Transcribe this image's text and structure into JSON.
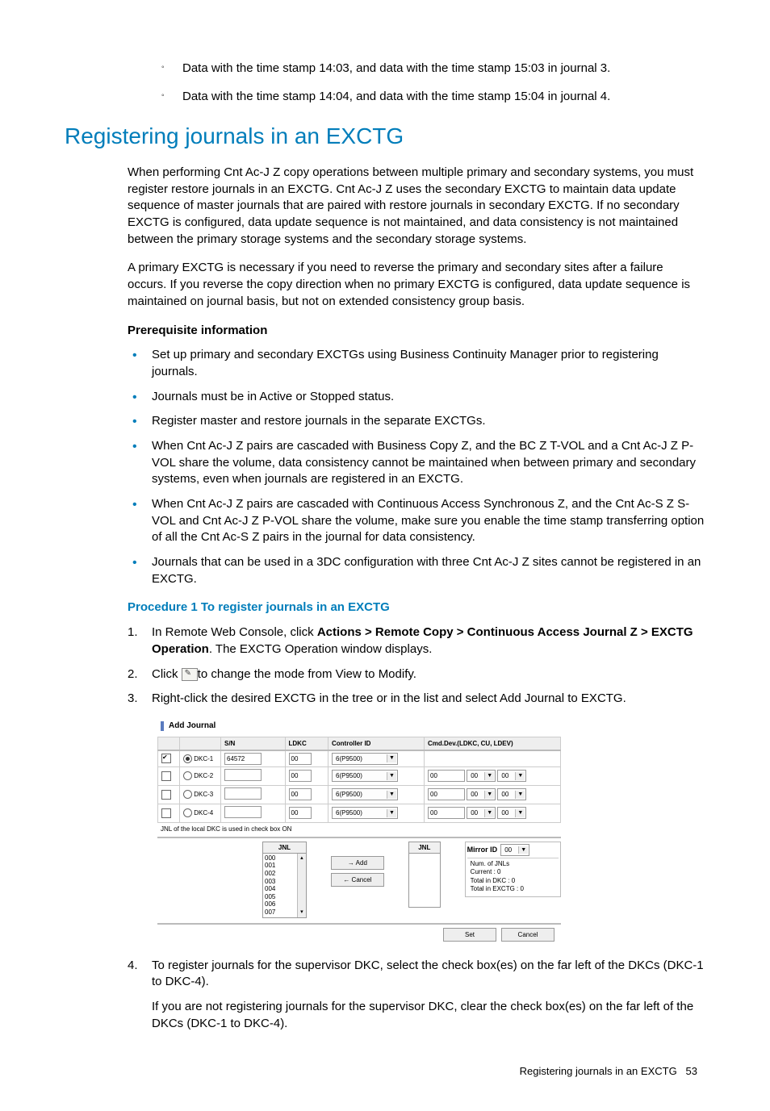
{
  "top_bullets": [
    "Data with the time stamp 14:03, and data with the time stamp 15:03 in journal 3.",
    "Data with the time stamp 14:04, and data with the time stamp 15:04 in journal 4."
  ],
  "heading": "Registering journals in an EXCTG",
  "para1": "When performing Cnt Ac-J Z copy operations between multiple primary and secondary systems, you must register restore journals in an EXCTG. Cnt Ac-J Z uses the secondary EXCTG to maintain data update sequence of master journals that are paired with restore journals in secondary EXCTG. If no secondary EXCTG is configured, data update sequence is not maintained, and data consistency is not maintained between the primary storage systems and the secondary storage systems.",
  "para2": "A primary EXCTG is necessary if you need to reverse the primary and secondary sites after a failure occurs. If you reverse the copy direction when no primary EXCTG is configured, data update sequence is maintained on journal basis, but not on extended consistency group basis.",
  "prereq_heading": "Prerequisite information",
  "prereqs": [
    "Set up primary and secondary EXCTGs using Business Continuity Manager prior to registering journals.",
    "Journals must be in Active or Stopped status.",
    "Register master and restore journals in the separate EXCTGs.",
    "When Cnt Ac-J Z pairs are cascaded with Business Copy Z, and the BC Z T-VOL and a Cnt Ac-J Z P-VOL share the volume, data consistency cannot be maintained when between primary and secondary systems, even when journals are registered in an EXCTG.",
    "When Cnt Ac-J Z pairs are cascaded with Continuous Access Synchronous Z, and the Cnt Ac-S Z S-VOL and Cnt Ac-J Z P-VOL share the volume, make sure you enable the time stamp transferring option of all the Cnt Ac-S Z pairs in the journal for data consistency.",
    "Journals that can be used in a 3DC configuration with three Cnt Ac-J Z sites cannot be registered in an EXCTG."
  ],
  "proc_heading": "Procedure 1 To register journals in an EXCTG",
  "step1_pre": "In Remote Web Console, click ",
  "step1_bold": "Actions > Remote Copy > Continuous Access Journal Z > EXCTG Operation",
  "step1_post": ". The EXCTG Operation window displays.",
  "step2_pre": "Click ",
  "step2_post": "to change the mode from View to Modify.",
  "step3": "Right-click the desired EXCTG in the tree or in the list and select Add Journal to EXCTG.",
  "step4a": "To register journals for the supervisor DKC, select the check box(es) on the far left of the DKCs (DKC-1 to DKC-4).",
  "step4b": "If you are not registering journals for the supervisor DKC, clear the check box(es) on the far left of the DKCs (DKC-1 to DKC-4).",
  "dialog": {
    "title": "Add Journal",
    "headers": {
      "sn": "S/N",
      "ldkc": "LDKC",
      "ctrl": "Controller ID",
      "cmd": "Cmd.Dev.(LDKC, CU, LDEV)"
    },
    "rows": [
      {
        "chk": true,
        "radio": true,
        "name": "DKC-1",
        "sn": "64572",
        "ldkc": "00",
        "ctrl": "6(P9500)",
        "cmd": false
      },
      {
        "chk": false,
        "radio": false,
        "name": "DKC-2",
        "sn": "",
        "ldkc": "00",
        "ctrl": "6(P9500)",
        "cmd": true
      },
      {
        "chk": false,
        "radio": false,
        "name": "DKC-3",
        "sn": "",
        "ldkc": "00",
        "ctrl": "6(P9500)",
        "cmd": true
      },
      {
        "chk": false,
        "radio": false,
        "name": "DKC-4",
        "sn": "",
        "ldkc": "00",
        "ctrl": "6(P9500)",
        "cmd": true
      }
    ],
    "note": "JNL of the local DKC is used in check box ON",
    "jnl_label": "JNL",
    "jnl_items": [
      "000",
      "001",
      "002",
      "003",
      "004",
      "005",
      "006",
      "007"
    ],
    "add_btn": "→ Add",
    "cancel_btn": "← Cancel",
    "mirror_label": "Mirror ID",
    "mirror_val": "00",
    "num_jnls": "Num. of JNLs",
    "current": "Current : 0",
    "total_dkc": "Total in DKC : 0",
    "total_exctg": "Total in EXCTG : 0",
    "set_btn": "Set",
    "cancel2_btn": "Cancel",
    "cmd_val": "00"
  },
  "footer_text": "Registering journals in an EXCTG",
  "footer_page": "53"
}
